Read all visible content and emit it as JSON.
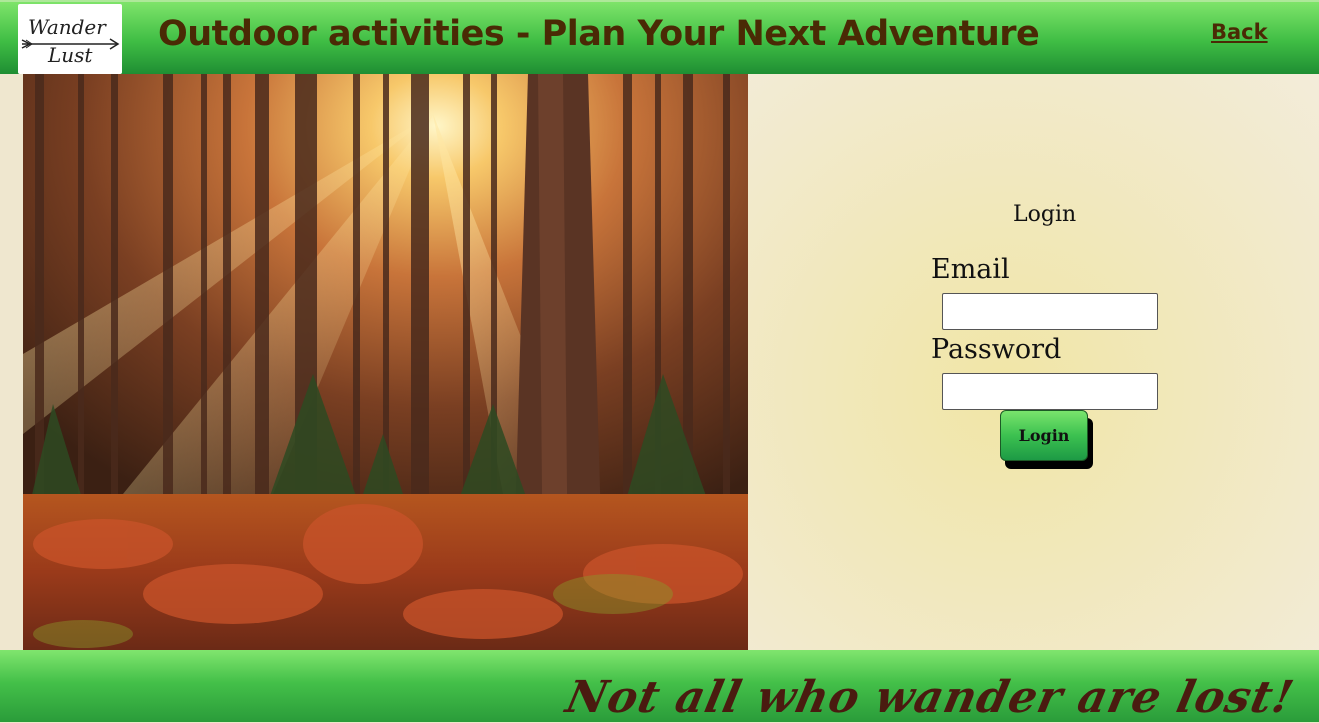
{
  "header": {
    "logo_text": "Wander Lust",
    "title": "Outdoor activities - Plan Your Next Adventure",
    "back_label": "Back"
  },
  "hero": {
    "image": "forest-sunlight-photo"
  },
  "login_form": {
    "heading": "Login",
    "email_label": "Email",
    "email_value": "",
    "password_label": "Password",
    "password_value": "",
    "submit_label": "Login"
  },
  "footer": {
    "tagline": "Not all who wander are lost!"
  },
  "colors": {
    "header_green": "#3fbd44",
    "title_brown": "#4a2a05",
    "panel_cream": "#f1e8bd",
    "tagline_brown": "#4a1b10"
  }
}
